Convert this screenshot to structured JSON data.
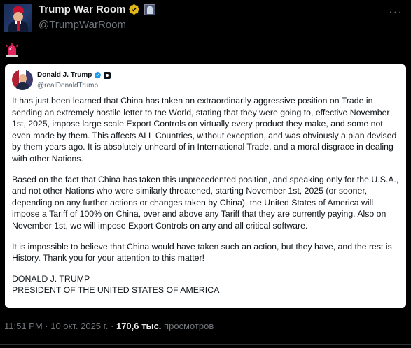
{
  "author": {
    "display_name": "Trump War Room",
    "handle": "@TrumpWarRoom"
  },
  "tweet": {
    "emoji": "rotating-light-emoji"
  },
  "quoted_post": {
    "author_name": "Donald J. Trump",
    "author_handle": "@realDonaldTrump",
    "paragraphs": [
      "It has just been learned that China has taken an extraordinarily aggressive position on Trade in sending an extremely hostile letter to the World, stating that they were going to, effective November 1st, 2025, impose large scale Export Controls on virtually every product they make, and some not even made by them. This affects ALL Countries, without exception, and was obviously a plan devised by them years ago. It is absolutely unheard of in International Trade, and a moral disgrace in dealing with other Nations.",
      "Based on the fact that China has taken this unprecedented position, and speaking only for the U.S.A., and not other Nations who were similarly threatened, starting November 1st, 2025 (or sooner, depending on any further actions or changes taken by China), the United States of America will impose a Tariff of 100% on China, over and above any Tariff that they are currently paying. Also on November 1st, we will impose Export Controls on any and all critical software.",
      "It is impossible to believe that China would have taken such an action, but they have, and the rest is History. Thank you for your attention to this matter!"
    ],
    "signature_line1": "DONALD J. TRUMP",
    "signature_line2": "PRESIDENT OF THE UNITED STATES OF AMERICA"
  },
  "meta": {
    "time_date": "11:51 PM · 10 окт. 2025 г. · ",
    "views_count": "170,6 тыс.",
    "views_label": " просмотров"
  },
  "colors": {
    "background": "#000000",
    "verified_gold": "#e2b719",
    "verified_blue": "#1d9bf0",
    "muted_text": "#71767b"
  }
}
